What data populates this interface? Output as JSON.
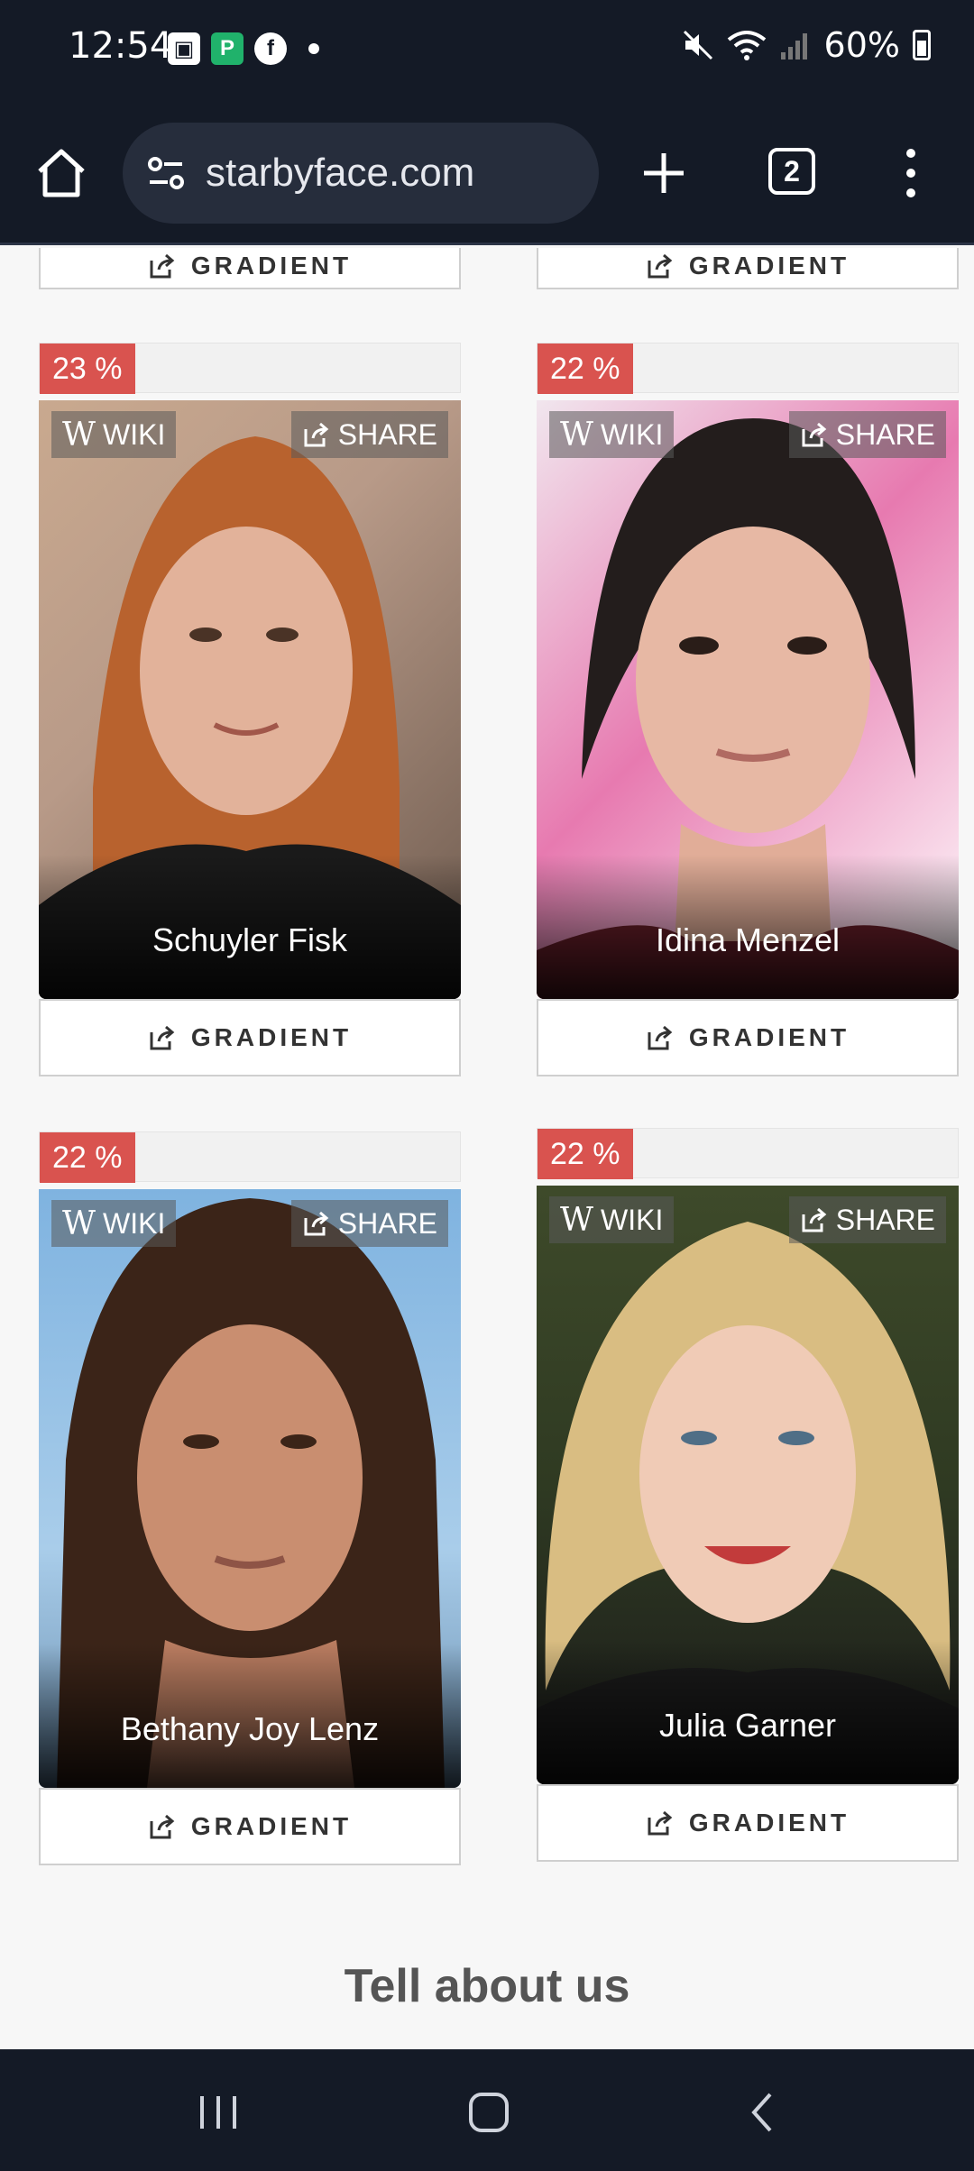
{
  "status_bar": {
    "time": "12:54",
    "battery": "60%"
  },
  "browser": {
    "url": "starbyface.com",
    "tab_count": "2"
  },
  "top_partial_buttons": [
    {
      "label": "GRADIENT"
    },
    {
      "label": "GRADIENT"
    }
  ],
  "cards": [
    {
      "percent": "23 %",
      "name": "Schuyler Fisk",
      "wiki_label": "WIKI",
      "share_label": "SHARE",
      "gradient_label": "GRADIENT"
    },
    {
      "percent": "22 %",
      "name": "Idina Menzel",
      "wiki_label": "WIKI",
      "share_label": "SHARE",
      "gradient_label": "GRADIENT"
    },
    {
      "percent": "22 %",
      "name": "Bethany Joy Lenz",
      "wiki_label": "WIKI",
      "share_label": "SHARE",
      "gradient_label": "GRADIENT"
    },
    {
      "percent": "22 %",
      "name": "Julia Garner",
      "wiki_label": "WIKI",
      "share_label": "SHARE",
      "gradient_label": "GRADIENT"
    }
  ],
  "footer": {
    "heading": "Tell about us"
  },
  "colors": {
    "badge": "#d9534f",
    "system_bar": "#141a26",
    "page_bg": "#f7f7f7"
  }
}
